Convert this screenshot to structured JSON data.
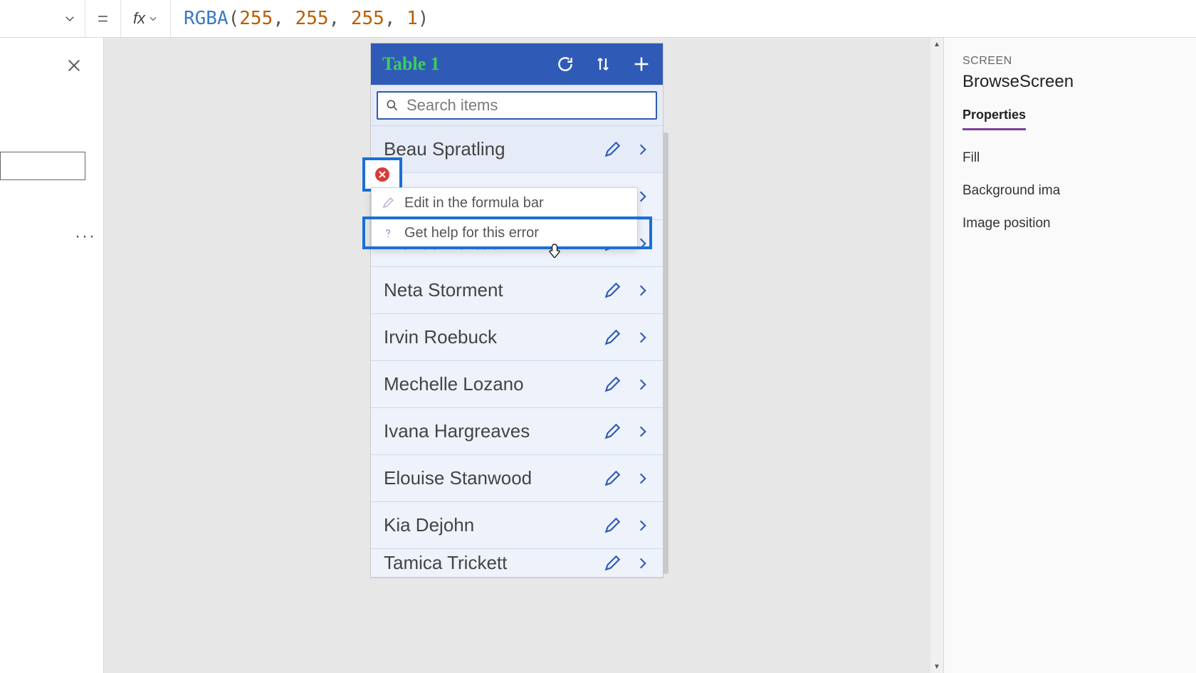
{
  "formula": {
    "fn": "RGBA",
    "args": [
      "255",
      "255",
      "255",
      "1"
    ]
  },
  "phone": {
    "title": "Table 1",
    "search_placeholder": "Search items",
    "items": [
      "Beau Spratling",
      "",
      "Alonso Partee",
      "Neta Storment",
      "Irvin Roebuck",
      "Mechelle Lozano",
      "Ivana Hargreaves",
      "Elouise Stanwood",
      "Kia Dejohn",
      "Tamica Trickett"
    ]
  },
  "ctx": {
    "edit_formula": "Edit in the formula bar",
    "get_help": "Get help for this error"
  },
  "right": {
    "category": "SCREEN",
    "name": "BrowseScreen",
    "tab_properties": "Properties",
    "fill": "Fill",
    "bg_image": "Background ima",
    "img_pos": "Image position"
  }
}
